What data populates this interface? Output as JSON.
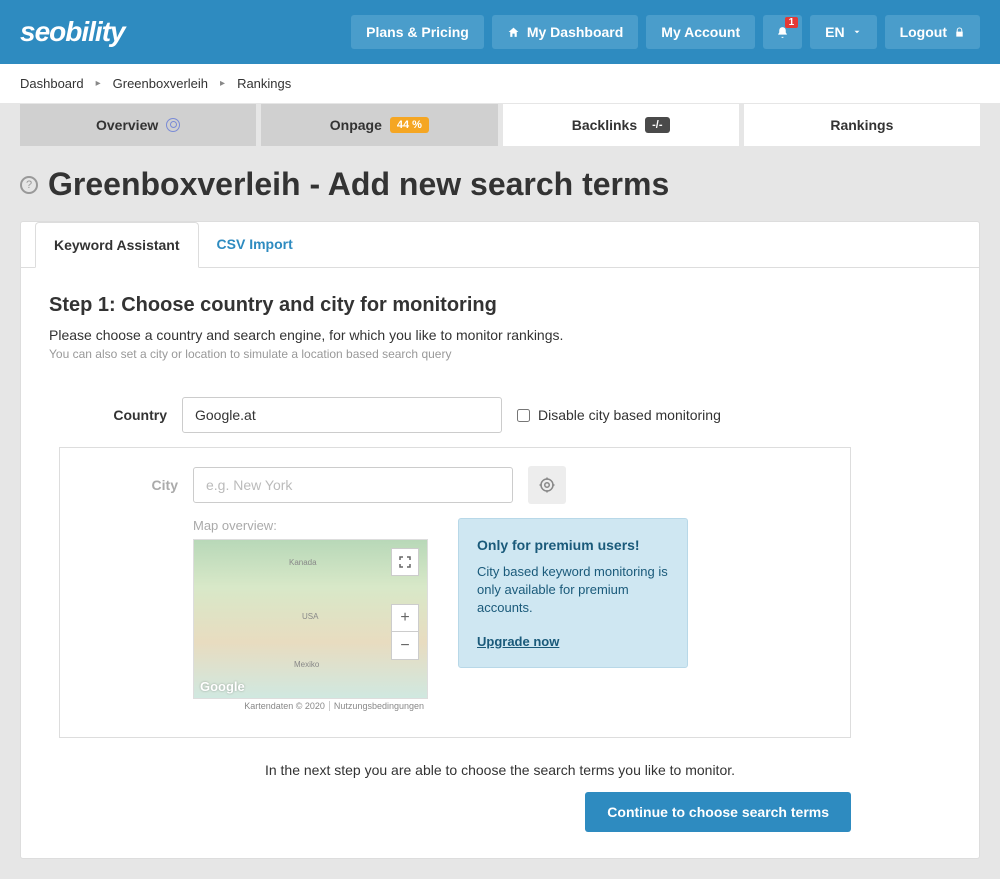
{
  "header": {
    "logo": "seobility",
    "nav": {
      "plans": "Plans & Pricing",
      "dashboard": "My Dashboard",
      "account": "My Account",
      "notif_count": "1",
      "lang": "EN",
      "logout": "Logout"
    }
  },
  "breadcrumb": {
    "items": [
      "Dashboard",
      "Greenboxverleih",
      "Rankings"
    ]
  },
  "tabs": {
    "overview": "Overview",
    "onpage": "Onpage",
    "onpage_badge": "44 %",
    "backlinks": "Backlinks",
    "backlinks_badge": "-/-",
    "rankings": "Rankings"
  },
  "page": {
    "title": "Greenboxverleih - Add new search terms"
  },
  "panel": {
    "tabs": {
      "assistant": "Keyword Assistant",
      "csv": "CSV Import"
    },
    "step_title": "Step 1: Choose country and city for monitoring",
    "step_desc": "Please choose a country and search engine, for which you like to monitor rankings.",
    "step_hint": "You can also set a city or location to simulate a location based search query",
    "form": {
      "country_label": "Country",
      "country_value": "Google.at",
      "disable_city_label": "Disable city based monitoring",
      "city_label": "City",
      "city_placeholder": "e.g. New York",
      "map_label": "Map overview:"
    },
    "map": {
      "countries": {
        "canada": "Kanada",
        "usa": "USA",
        "mexico": "Mexiko"
      },
      "logo": "Google",
      "attrib1": "Kartendaten © 2020",
      "attrib2": "Nutzungsbedingungen"
    },
    "premium": {
      "title": "Only for premium users!",
      "desc": "City based keyword monitoring is only available for premium accounts.",
      "link": "Upgrade now"
    },
    "next_hint": "In the next step you are able to choose the search terms you like to monitor.",
    "continue": "Continue to choose search terms"
  }
}
